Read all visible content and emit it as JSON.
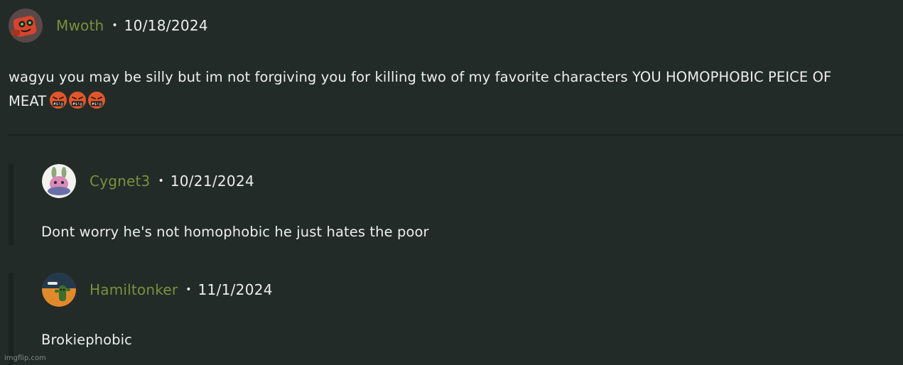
{
  "main_comment": {
    "username": "Mwoth",
    "separator": "•",
    "date": "10/18/2024",
    "text_line1": " wagyu you may be silly but im not forgiving you for killing two of my favorite characters YOU HOMOPHOBIC PEICE OF",
    "text_line2": "MEAT",
    "emoji": [
      "face-with-symbols-on-mouth",
      "face-with-symbols-on-mouth",
      "face-with-symbols-on-mouth"
    ],
    "emoji_glyph": "#$!@"
  },
  "replies": [
    {
      "username": "Cygnet3",
      "separator": "•",
      "date": "10/21/2024",
      "text": "Dont worry he's not homophobic he just hates the poor"
    },
    {
      "username": "Hamiltonker",
      "separator": "•",
      "date": "11/1/2024",
      "text": "Brokiephobic"
    }
  ],
  "watermark": "imgflip.com",
  "colors": {
    "background": "#232b28",
    "username": "#7c8f3c",
    "text": "#eceeed",
    "divider": "#1b2220"
  }
}
